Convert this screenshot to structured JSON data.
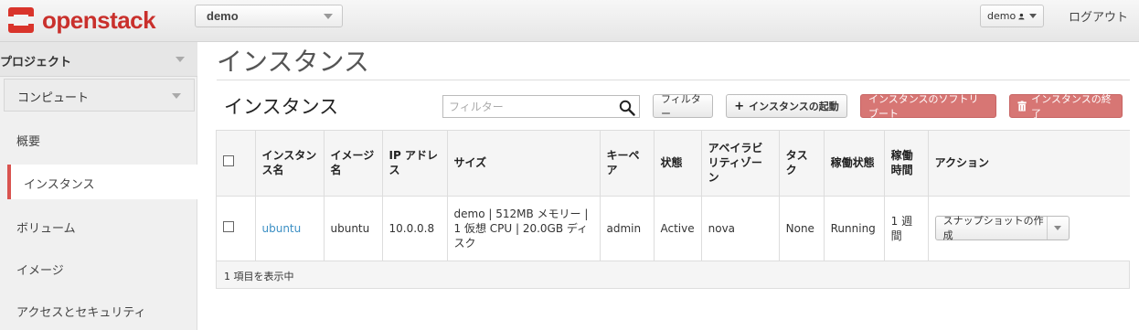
{
  "header": {
    "brand": "openstack",
    "project_selector": "demo",
    "user_menu": "demo",
    "logout": "ログアウト"
  },
  "sidebar": {
    "project_label": "プロジェクト",
    "compute_label": "コンピュート",
    "items": [
      {
        "label": "概要"
      },
      {
        "label": "インスタンス"
      },
      {
        "label": "ボリューム"
      },
      {
        "label": "イメージ"
      },
      {
        "label": "アクセスとセキュリティ"
      }
    ]
  },
  "main": {
    "page_title": "インスタンス",
    "section_title": "インスタンス",
    "filter_placeholder": "フィルター",
    "buttons": {
      "filter": "フィルター",
      "launch": "インスタンスの起動",
      "soft_reboot": "インスタンスのソフトリブート",
      "terminate": "インスタンスの終了"
    },
    "table": {
      "columns": [
        "インスタンス名",
        "イメージ名",
        "IP アドレス",
        "サイズ",
        "キーペア",
        "状態",
        "アベイラビリティゾーン",
        "タスク",
        "稼働状態",
        "稼働時間",
        "アクション"
      ],
      "rows": [
        {
          "name": "ubuntu",
          "image": "ubuntu",
          "ip": "10.0.0.8",
          "size": "demo | 512MB メモリー | 1 仮想 CPU | 20.0GB ディスク",
          "keypair": "admin",
          "status": "Active",
          "zone": "nova",
          "task": "None",
          "power": "Running",
          "uptime": "1 週間",
          "action": "スナップショットの作成"
        }
      ],
      "footer": "1 項目を表示中"
    }
  },
  "colors": {
    "brand_red": "#c9302c",
    "danger": "#d77674",
    "link": "#3b8fc4"
  }
}
